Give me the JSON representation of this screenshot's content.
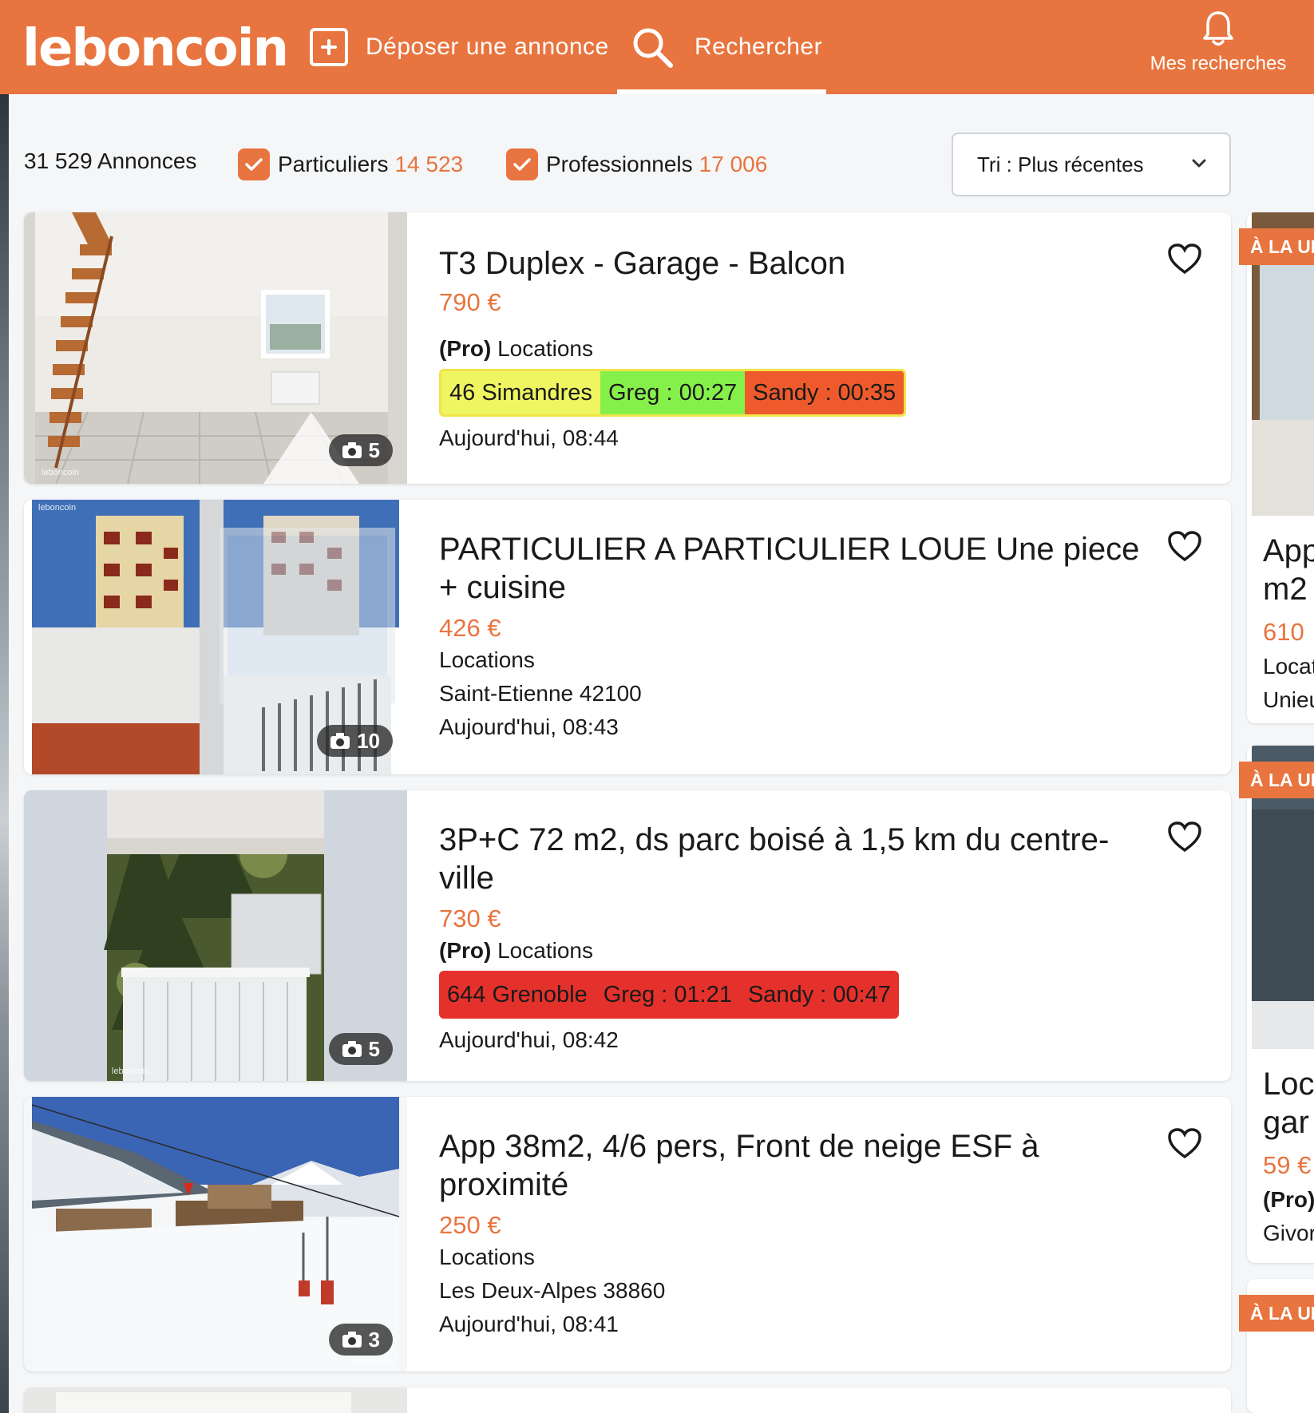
{
  "header": {
    "logo": "leboncoin",
    "deposit_label": "Déposer une annonce",
    "search_label": "Rechercher",
    "saved_searches_label": "Mes recherches"
  },
  "filters": {
    "total": "31 529 Annonces",
    "particuliers_label": "Particuliers",
    "particuliers_count": "14 523",
    "pros_label": "Professionnels",
    "pros_count": "17 006",
    "sort_label": "Tri : Plus récentes"
  },
  "listings": [
    {
      "title": "T3 Duplex - Garage - Balcon",
      "price": "790 €",
      "pro": "(Pro)",
      "category": "Locations",
      "highlight": [
        "46 Simandres",
        "Greg : 00:27",
        "Sandy : 00:35"
      ],
      "date": "Aujourd'hui, 08:44",
      "photo_count": "5"
    },
    {
      "title": "PARTICULIER A PARTICULIER LOUE Une piece + cuisine",
      "price": "426 €",
      "category": "Locations",
      "location": "Saint-Etienne 42100",
      "date": "Aujourd'hui, 08:43",
      "photo_count": "10"
    },
    {
      "title": "3P+C 72 m2, ds parc boisé à 1,5 km du centre-ville",
      "price": "730 €",
      "pro": "(Pro)",
      "category": "Locations",
      "highlight": [
        "644 Grenoble",
        "Greg : 01:21",
        "Sandy : 00:47"
      ],
      "date": "Aujourd'hui, 08:42",
      "photo_count": "5"
    },
    {
      "title": "App 38m2, 4/6 pers, Front de neige ESF à proximité",
      "price": "250 €",
      "category": "Locations",
      "location": "Les Deux-Alpes 38860",
      "date": "Aujourd'hui, 08:41",
      "photo_count": "3"
    }
  ],
  "side": {
    "ribbon": "À LA UNE",
    "card1": {
      "title1": "App",
      "title2": "m2",
      "price": "610",
      "category": "Locat",
      "location": "Unieu"
    },
    "card2": {
      "title1": "Loc",
      "title2": "gar",
      "price": "59 €",
      "pro": "(Pro)",
      "location": "Givor"
    }
  },
  "watermark": "leboncoin",
  "colors": {
    "brand": "#e8743f",
    "highlight_yellow": "#eef560",
    "highlight_green": "#86f04a",
    "highlight_orange": "#ee5a2c",
    "highlight_red": "#e5312b"
  }
}
